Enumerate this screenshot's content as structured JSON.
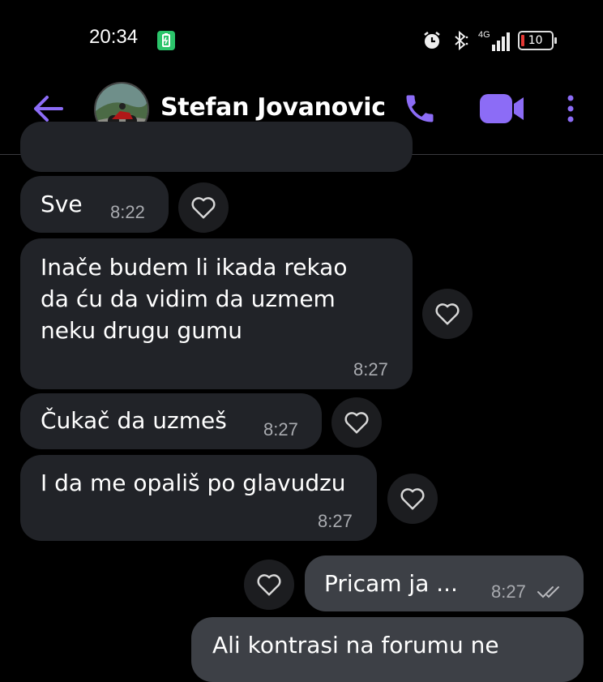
{
  "status_bar": {
    "time": "20:34",
    "network": "4G",
    "battery_level": "10"
  },
  "header": {
    "contact_name": "Stefan Jovanovic"
  },
  "messages": [
    {
      "text": "Sve",
      "time": "8:22"
    },
    {
      "text": "Inače budem li ikada rekao da ću da vidim da uzmem neku drugu gumu",
      "line1": "Inače budem li ikada rekao",
      "line2": "da ću da vidim da uzmem",
      "line3": "neku drugu gumu",
      "time": "8:27"
    },
    {
      "text": "Čukač da uzmeš",
      "time": "8:27"
    },
    {
      "text": "I da me opališ po glavudzu",
      "time": "8:27"
    },
    {
      "text": "Pricam ja ...",
      "time": "8:27",
      "outgoing": true
    },
    {
      "text": "Ali kontrasi na forumu ne",
      "outgoing": true
    }
  ],
  "colors": {
    "accent": "#8c6cf6",
    "incoming_bubble": "#212328",
    "outgoing_bubble": "#3d4046",
    "time_text": "#a9abb0"
  },
  "icons": [
    "back-arrow-icon",
    "phone-icon",
    "video-icon",
    "more-icon",
    "heart-icon",
    "double-check-icon"
  ]
}
